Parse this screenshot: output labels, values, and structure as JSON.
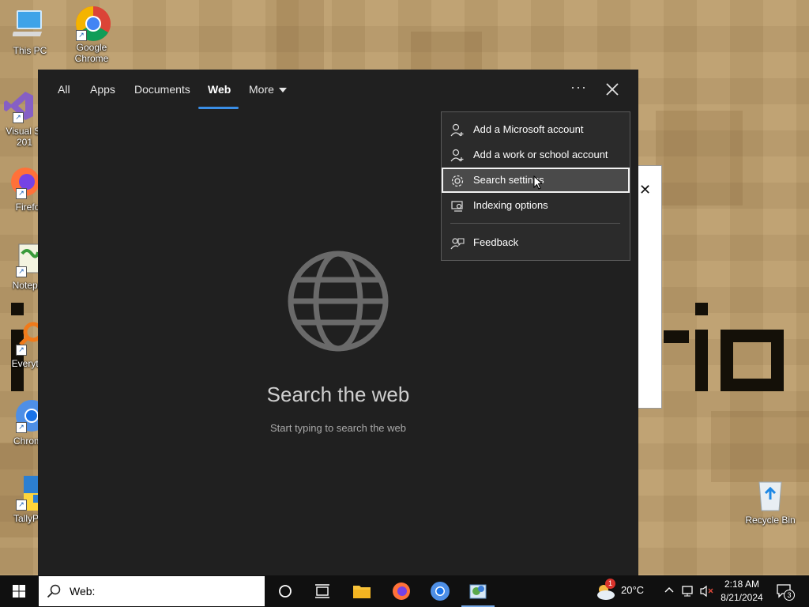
{
  "desktop": {
    "icons": [
      {
        "label_line1": "This PC",
        "label_line2": ""
      },
      {
        "label_line1": "Google",
        "label_line2": "Chrome"
      },
      {
        "label_line1": "Visual St",
        "label_line2": "201"
      },
      {
        "label_line1": "Firefo",
        "label_line2": ""
      },
      {
        "label_line1": "Notepa",
        "label_line2": ""
      },
      {
        "label_line1": "Everyth",
        "label_line2": ""
      },
      {
        "label_line1": "Chrom",
        "label_line2": ""
      },
      {
        "label_line1": "TallyPr",
        "label_line2": ""
      },
      {
        "label_line1": "Recycle Bin",
        "label_line2": ""
      }
    ]
  },
  "search_panel": {
    "tabs": [
      {
        "label": "All",
        "active": false
      },
      {
        "label": "Apps",
        "active": false
      },
      {
        "label": "Documents",
        "active": false
      },
      {
        "label": "Web",
        "active": true
      },
      {
        "label": "More",
        "active": false
      }
    ],
    "ellipsis": "···",
    "title": "Search the web",
    "subtitle": "Start typing to search the web",
    "accent_color": "#3a8ee6"
  },
  "menu": {
    "items": [
      {
        "label": "Add a Microsoft account",
        "icon": "person-add-icon"
      },
      {
        "label": "Add a work or school account",
        "icon": "person-add-icon"
      },
      {
        "label": "Search settings",
        "icon": "gear-icon",
        "highlighted": true
      },
      {
        "label": "Indexing options",
        "icon": "indexing-icon"
      },
      {
        "label": "Feedback",
        "icon": "feedback-icon"
      }
    ]
  },
  "taskbar": {
    "search_text": "Web:",
    "weather_temp": "20°C",
    "weather_badge": "1",
    "time": "2:18 AM",
    "date": "8/21/2024",
    "notifications_count": "3"
  }
}
